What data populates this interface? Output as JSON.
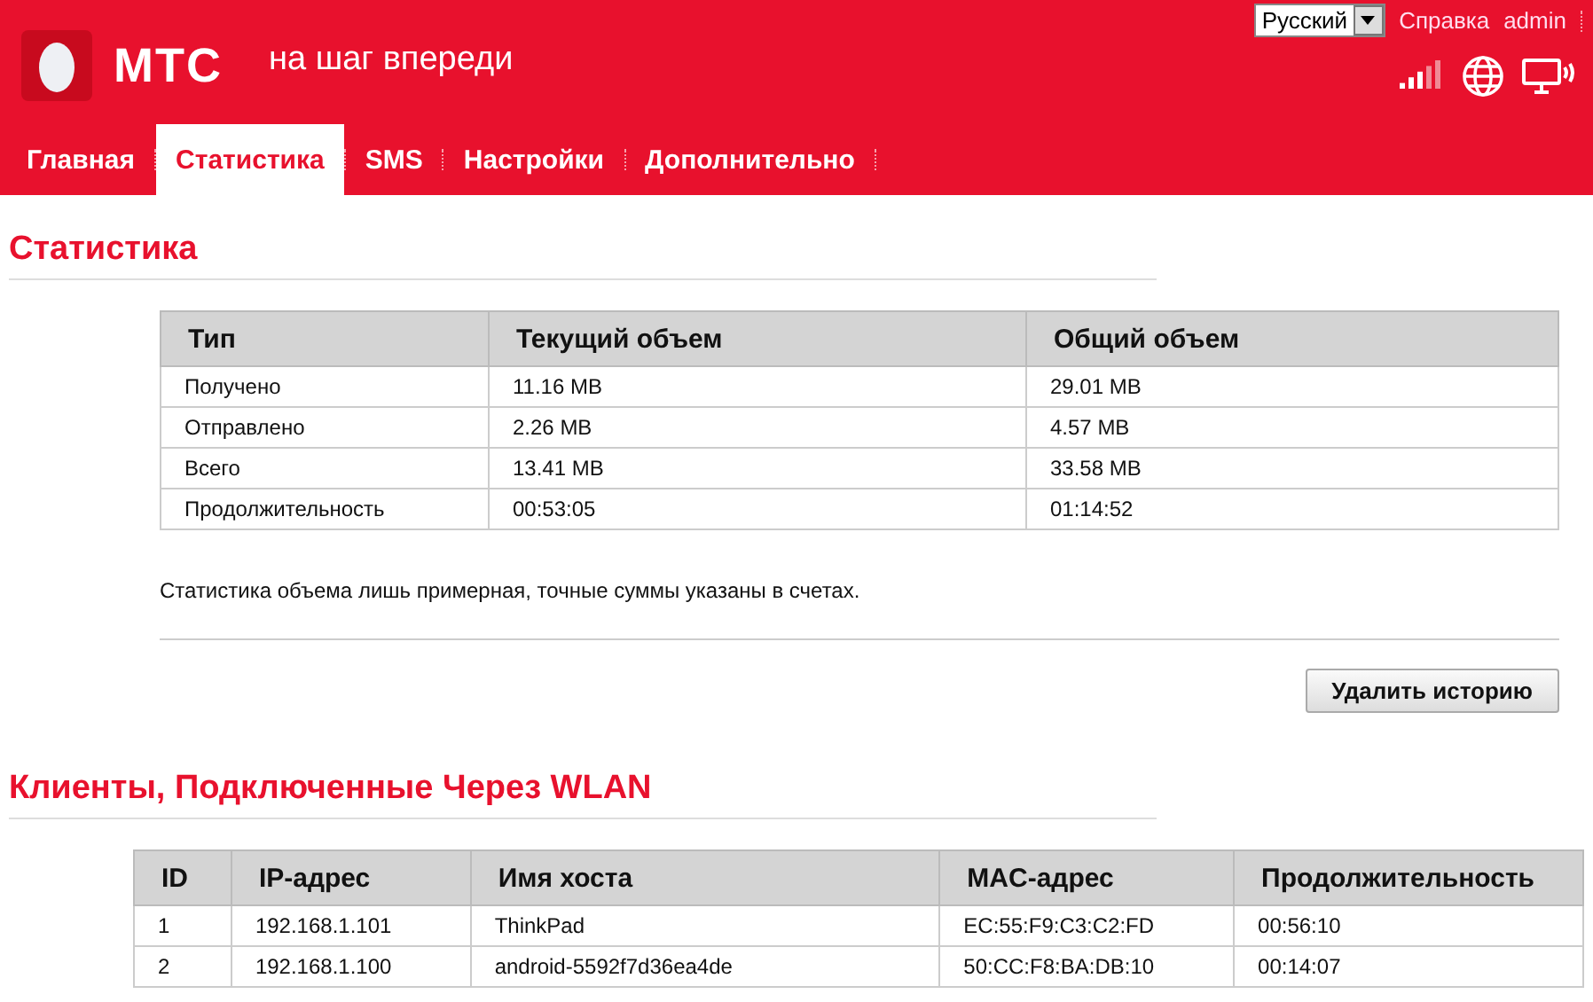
{
  "header": {
    "logo": "МТС",
    "tagline": "на шаг впереди",
    "language": "Русский",
    "links": [
      "Справка",
      "admin"
    ]
  },
  "tabs": [
    {
      "label": "Главная",
      "selected": false
    },
    {
      "label": "Статистика",
      "selected": true
    },
    {
      "label": "SMS",
      "selected": false
    },
    {
      "label": "Настройки",
      "selected": false
    },
    {
      "label": "Дополнительно",
      "selected": false
    }
  ],
  "statistics": {
    "title": "Статистика",
    "columns": [
      "Тип",
      "Текущий объем",
      "Общий объем"
    ],
    "rows": [
      [
        "Получено",
        "11.16 MB",
        "29.01 MB"
      ],
      [
        "Отправлено",
        "2.26 MB",
        "4.57 MB"
      ],
      [
        "Всего",
        "13.41 MB",
        "33.58 MB"
      ],
      [
        "Продолжительность",
        "00:53:05",
        "01:14:52"
      ]
    ],
    "note": "Статистика объема лишь примерная, точные суммы указаны в счетах.",
    "button": "Удалить историю"
  },
  "clients": {
    "title": "Клиенты, Подключенные Через WLAN",
    "columns": [
      "ID",
      "IP-адрес",
      "Имя хоста",
      "MAC-адрес",
      "Продолжительность"
    ],
    "rows": [
      [
        "1",
        "192.168.1.101",
        "ThinkPad",
        "EC:55:F9:C3:C2:FD",
        "00:56:10"
      ],
      [
        "2",
        "192.168.1.100",
        "android-5592f7d36ea4de",
        "50:CC:F8:BA:DB:10",
        "00:14:07"
      ]
    ]
  }
}
